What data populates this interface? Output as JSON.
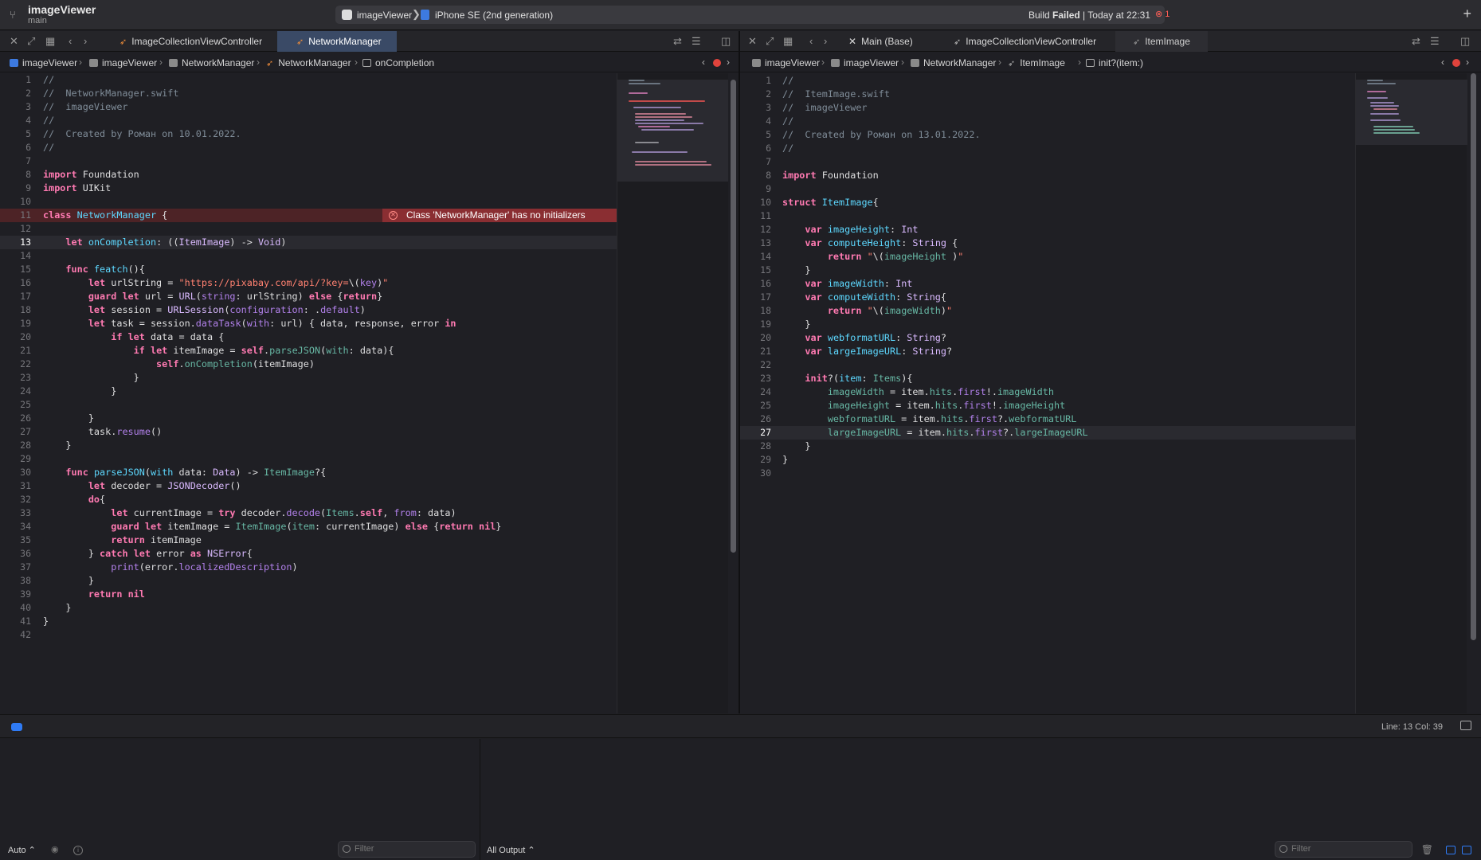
{
  "titlebar": {
    "project": "imageViewer",
    "branch": "main",
    "scheme_app": "imageViewer",
    "scheme_separator": "❯",
    "scheme_device": "iPhone SE (2nd generation)",
    "build_prefix": "Build ",
    "build_state": "Failed",
    "build_time": " | Today at 22:31",
    "error_count": "1",
    "add_label": "+"
  },
  "left_tabs": [
    {
      "label": "ImageCollectionViewController"
    },
    {
      "label": "NetworkManager"
    }
  ],
  "right_tabs": [
    {
      "label": "Main (Base)"
    },
    {
      "label": "ImageCollectionViewController"
    },
    {
      "label": "ItemImage"
    }
  ],
  "left_breadcrumb": [
    "imageViewer",
    "imageViewer",
    "NetworkManager",
    "NetworkManager",
    "onCompletion"
  ],
  "right_breadcrumb": [
    "imageViewer",
    "imageViewer",
    "NetworkManager",
    "ItemImage",
    "init?(item:)"
  ],
  "left_editor": {
    "error_message": "Class 'NetworkManager' has no initializers",
    "current_line": 13
  },
  "right_editor": {
    "current_line": 27
  },
  "status": {
    "line_col": "Line: 13  Col: 39"
  },
  "console": {
    "auto_label": "Auto ⌃",
    "filter_placeholder": "Filter",
    "output_label": "All Output ⌃",
    "right_filter_placeholder": "Filter"
  },
  "colors": {
    "accent": "#2f7bf5",
    "error": "#e0433c",
    "keyword": "#ff7ab2",
    "string": "#ff8170",
    "comment": "#7f8c98"
  }
}
